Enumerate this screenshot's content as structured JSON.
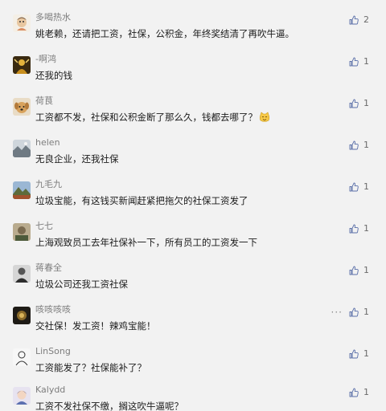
{
  "comments": [
    {
      "nickname": "多喝热水",
      "content": "姚老赖，还请把工资，社保，公积金，年终奖结清了再吹牛逼。",
      "likes": "2",
      "avatar_icon": "cartoon-avatar-icon"
    },
    {
      "nickname": "-啊鸿",
      "content": "还我的钱",
      "likes": "1",
      "avatar_icon": "golden-figure-avatar-icon"
    },
    {
      "nickname": "荷茛",
      "content": "工资都不发，社保和公积金断了那么久，钱都去哪了？",
      "likes": "1",
      "avatar_icon": "dog-avatar-icon",
      "emoji_icon": "cat-face-emoji-icon"
    },
    {
      "nickname": "helen",
      "content": "无良企业，还我社保",
      "likes": "1",
      "avatar_icon": "landscape-avatar-icon"
    },
    {
      "nickname": "九毛九",
      "content": "垃圾宝能，有这钱买新闻赶紧把拖欠的社保工资发了",
      "likes": "1",
      "avatar_icon": "mountain-avatar-icon"
    },
    {
      "nickname": "七七",
      "content": "上海观致员工去年社保补一下，所有员工的工资发一下",
      "likes": "1",
      "avatar_icon": "photo-avatar-icon"
    },
    {
      "nickname": "蒋春全",
      "content": "垃圾公司还我工资社保",
      "likes": "1",
      "avatar_icon": "portrait-avatar-icon"
    },
    {
      "nickname": "咳咳咳咳",
      "content": "交社保！发工资！辣鸡宝能！",
      "likes": "1",
      "avatar_icon": "dark-scene-avatar-icon",
      "show_more": true,
      "more_label": "···"
    },
    {
      "nickname": "LinSong",
      "content": "工资能发了？社保能补了？",
      "likes": "1",
      "avatar_icon": "sketch-person-avatar-icon"
    },
    {
      "nickname": "Kalydd",
      "content": "工资不发社保不缴，搁这吹牛逼呢？",
      "likes": "1",
      "avatar_icon": "anime-avatar-icon"
    }
  ],
  "colors": {
    "background": "#f2f2f2",
    "nickname": "#7d7d7d",
    "content": "#1b1b1b",
    "like_icon": "#5a6fa8"
  }
}
